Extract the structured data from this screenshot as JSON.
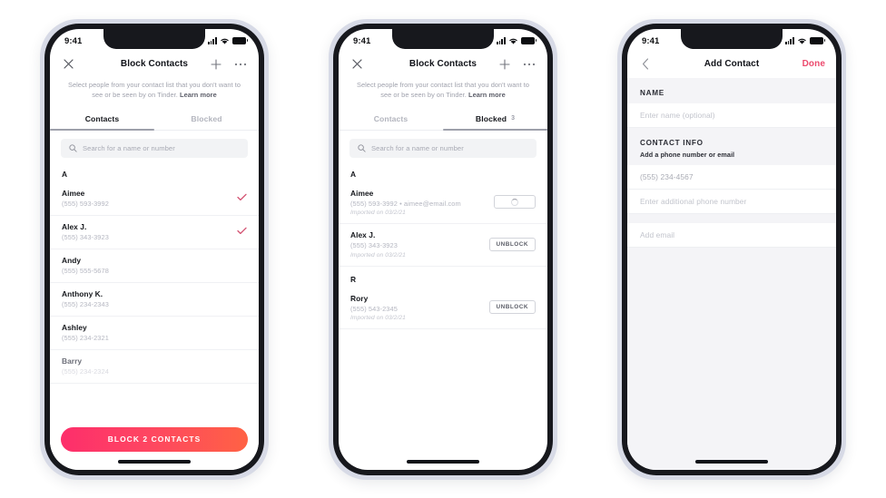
{
  "status_bar": {
    "time": "9:41",
    "signal_icon": "cellular-bars-icon",
    "wifi_icon": "wifi-icon",
    "battery_icon": "battery-icon"
  },
  "colors": {
    "accent_gradient_start": "#fd2e6b",
    "accent_gradient_end": "#ff6244",
    "done_pink": "#ec4a6d",
    "check_red": "#d35070",
    "text_dark": "#15171c",
    "text_muted": "#b4b6c0",
    "screen_bg": "#ffffff",
    "form_bg": "#f4f4f7"
  },
  "phone1": {
    "nav": {
      "close_icon": "close-icon",
      "title": "Block Contacts",
      "add_icon": "plus-icon",
      "more_icon": "overflow-menu-icon"
    },
    "subtitle": {
      "text": "Select people from your contact list that you don't want to see or be seen by on Tinder. ",
      "link": "Learn more"
    },
    "tabs": [
      {
        "label": "Contacts",
        "active": true,
        "badge": ""
      },
      {
        "label": "Blocked",
        "active": false,
        "badge": ""
      }
    ],
    "search": {
      "icon": "search-icon",
      "placeholder": "Search for a name or number",
      "value": ""
    },
    "sections": [
      {
        "letter": "A",
        "rows": [
          {
            "name": "Aimee",
            "phone": "(555) 593-3992",
            "selected": true,
            "faded": false
          },
          {
            "name": "Alex J.",
            "phone": "(555) 343-3923",
            "selected": true,
            "faded": false
          },
          {
            "name": "Andy",
            "phone": "(555) 555-5678",
            "selected": false,
            "faded": false
          },
          {
            "name": "Anthony K.",
            "phone": "(555) 234-2343",
            "selected": false,
            "faded": false
          },
          {
            "name": "Ashley",
            "phone": "(555) 234-2321",
            "selected": false,
            "faded": false
          },
          {
            "name": "Barry",
            "phone": "(555) 234-2324",
            "selected": false,
            "faded": true
          }
        ]
      }
    ],
    "cta_label": "BLOCK 2 CONTACTS"
  },
  "phone2": {
    "nav": {
      "close_icon": "close-icon",
      "title": "Block Contacts",
      "add_icon": "plus-icon",
      "more_icon": "overflow-menu-icon"
    },
    "subtitle": {
      "text": "Select people from your contact list that you don't want to see or be seen by on Tinder. ",
      "link": "Learn more"
    },
    "tabs": [
      {
        "label": "Contacts",
        "active": false,
        "badge": ""
      },
      {
        "label": "Blocked",
        "active": true,
        "badge": "3"
      }
    ],
    "search": {
      "icon": "search-icon",
      "placeholder": "Search for a name or number",
      "value": ""
    },
    "sections": [
      {
        "letter": "A",
        "rows": [
          {
            "name": "Aimee",
            "phone": "(555) 593-3992  •  aimee@email.com",
            "imported": "Imported on 03/2/21",
            "action": "spinner",
            "action_label": ""
          },
          {
            "name": "Alex J.",
            "phone": "(555) 343-3923",
            "imported": "Imported on 03/2/21",
            "action": "button",
            "action_label": "UNBLOCK"
          }
        ]
      },
      {
        "letter": "R",
        "rows": [
          {
            "name": "Rory",
            "phone": "(555) 543-2345",
            "imported": "Imported on 03/2/21",
            "action": "button",
            "action_label": "UNBLOCK"
          }
        ]
      }
    ]
  },
  "phone3": {
    "nav": {
      "back_icon": "chevron-left-icon",
      "title": "Add Contact",
      "done_label": "Done"
    },
    "name_section": {
      "title": "NAME",
      "field_placeholder": "Enter name (optional)",
      "field_value": ""
    },
    "contact_section": {
      "title": "CONTACT INFO",
      "note": "Add a phone number or email",
      "fields": [
        {
          "placeholder": "(555) 234-4567",
          "value": "(555) 234-4567",
          "filled": true
        },
        {
          "placeholder": "Enter additional phone number",
          "value": "",
          "filled": false
        }
      ],
      "email_field": {
        "placeholder": "Add email",
        "value": "",
        "filled": false
      }
    }
  }
}
